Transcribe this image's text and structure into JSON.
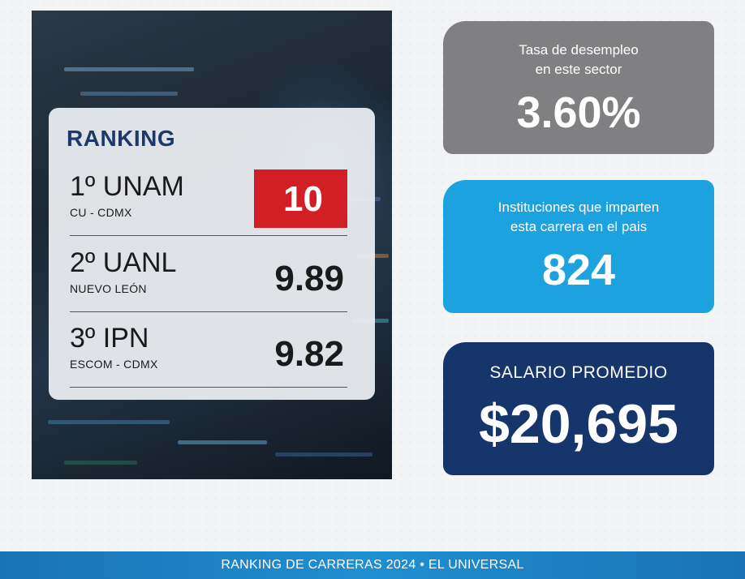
{
  "ranking": {
    "title": "RANKING",
    "items": [
      {
        "name": "1º UNAM",
        "location": "CU - CDMX",
        "score": "10"
      },
      {
        "name": "2º UANL",
        "location": "NUEVO LEÓN",
        "score": "9.89"
      },
      {
        "name": "3º IPN",
        "location": "ESCOM - CDMX",
        "score": "9.82"
      }
    ]
  },
  "stats": {
    "unemployment": {
      "label_line1": "Tasa de desempleo",
      "label_line2": "en este sector",
      "value": "3.60%"
    },
    "institutions": {
      "label_line1": "Instituciones que imparten",
      "label_line2": "esta carrera en el pais",
      "value": "824"
    },
    "salary": {
      "label": "SALARIO PROMEDIO",
      "value": "$20,695"
    }
  },
  "footer": {
    "text": "RANKING DE CARRERAS 2024 • EL UNIVERSAL"
  },
  "colors": {
    "highlight_red": "#d21f26",
    "gray_card": "#808082",
    "light_blue_card": "#1ca2df",
    "navy_card": "#15356b",
    "brand_navy_text": "#1b3a6b",
    "footer_blue": "#1f8fd0"
  }
}
